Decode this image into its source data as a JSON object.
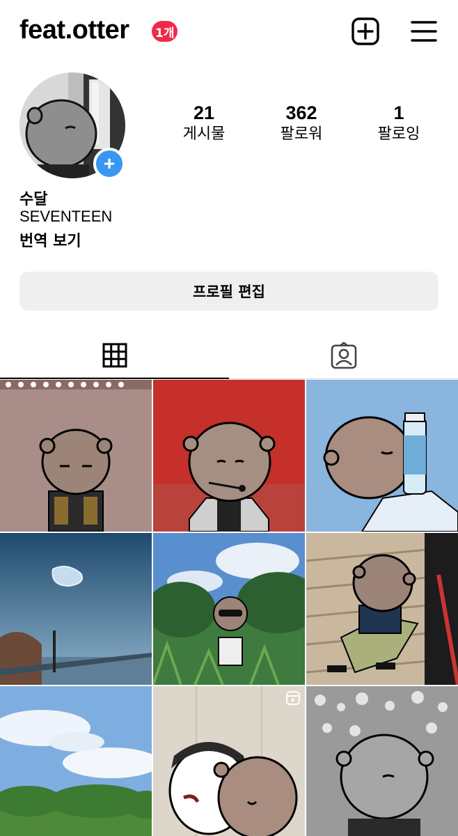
{
  "header": {
    "username": "feat.otter",
    "notification_badge": "1개",
    "icons": [
      "new-post-icon",
      "menu-icon"
    ]
  },
  "profile": {
    "stats": [
      {
        "value": "21",
        "label": "게시물"
      },
      {
        "value": "362",
        "label": "팔로워"
      },
      {
        "value": "1",
        "label": "팔로잉"
      }
    ],
    "name": "수달",
    "bio": "SEVENTEEN",
    "translate_label": "번역 보기",
    "edit_button": "프로필 편집"
  },
  "tabs": {
    "active": "grid",
    "items": [
      {
        "id": "grid",
        "icon": "grid-icon"
      },
      {
        "id": "tagged",
        "icon": "tagged-icon"
      }
    ]
  },
  "posts": [
    {
      "type": "image",
      "subject": "otter-character-jacket"
    },
    {
      "type": "image",
      "subject": "otter-character-red-background"
    },
    {
      "type": "image",
      "subject": "otter-character-water-bottle"
    },
    {
      "type": "image",
      "subject": "sky-water-drop-landscape"
    },
    {
      "type": "image",
      "subject": "otter-sunglasses-forest"
    },
    {
      "type": "image",
      "subject": "otter-stairs"
    },
    {
      "type": "image",
      "subject": "sky-clouds-forest"
    },
    {
      "type": "reel",
      "subject": "two-characters"
    },
    {
      "type": "image",
      "subject": "otter-concert-grayscale"
    }
  ],
  "colors": {
    "badge": "#ef2a48",
    "accent_blue": "#3897f0",
    "button_bg": "#efefef"
  }
}
